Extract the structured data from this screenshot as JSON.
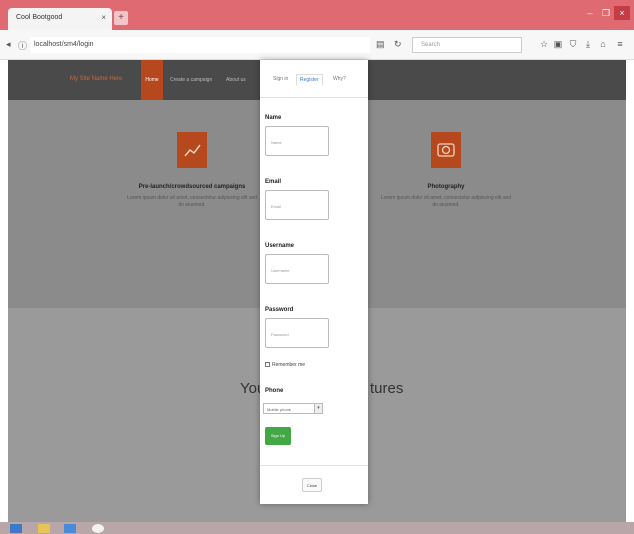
{
  "browser": {
    "tab_title": "Cool Bootgood",
    "tab_close": "×",
    "new_tab": "+",
    "url": "localhost/sm4/login",
    "search_placeholder": "Search",
    "accent": "#e06a72",
    "controls": [
      "–",
      "❐",
      "×"
    ]
  },
  "site": {
    "brand": "My Site Name Here",
    "nav_active": "Home",
    "nav_links": [
      "Create a campaign",
      "About us"
    ],
    "features": [
      {
        "title": "Pre-launch/crowdsourced campaigns",
        "desc": "Lorem ipsum dolor sit amet, consectetur adipiscing elit sed do eiusmod."
      },
      {
        "title": "Photography",
        "desc": "Lorem ipsum dolor sit amet, consectetur adipiscing elit sed do eiusmod."
      }
    ],
    "big_text_left": "You",
    "big_text_right": "tures",
    "accent": "#b5491d"
  },
  "modal": {
    "tabs": [
      "Sign in",
      "Register",
      "Why?"
    ],
    "active_tab": "Register",
    "fields": [
      {
        "label": "Name",
        "placeholder": "Name"
      },
      {
        "label": "Email",
        "placeholder": "Email"
      },
      {
        "label": "Username",
        "placeholder": "Username"
      },
      {
        "label": "Password",
        "placeholder": "Password"
      }
    ],
    "remember": "Remember me",
    "phone_label": "Phone",
    "phone_select": "Mobile phone",
    "signup": "Sign Up",
    "close": "Close",
    "success_color": "#41a845"
  }
}
